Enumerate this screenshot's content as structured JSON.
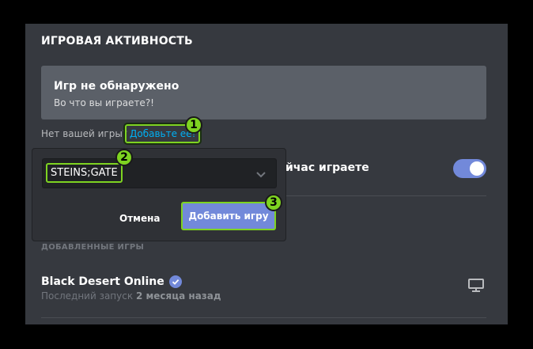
{
  "section": {
    "title": "ИГРОВАЯ АКТИВНОСТЬ"
  },
  "no_game": {
    "title": "Игр не обнаружено",
    "subtitle": "Во что вы играете?!"
  },
  "missing": {
    "text": "Нет вашей игры?",
    "link": "Добавьте ее!"
  },
  "now_playing": {
    "label": "йчас играете",
    "toggle_on": true
  },
  "popup": {
    "select_value": "STEINS;GATE",
    "cancel_label": "Отмена",
    "add_label": "Добавить игру"
  },
  "badges": [
    "1",
    "2",
    "3"
  ],
  "added_games": {
    "heading": "ДОБАВЛЕННЫЕ ИГРЫ",
    "items": [
      {
        "name": "Black Desert Online",
        "last_prefix": "Последний запуск",
        "last_value": "2 месяца назад"
      }
    ]
  },
  "colors": {
    "accent": "#7289da",
    "highlight": "#7ed321",
    "link": "#00b0f4",
    "panel": "#36393f"
  },
  "icons": [
    "chevron-down-icon",
    "verified-icon",
    "monitor-icon"
  ]
}
